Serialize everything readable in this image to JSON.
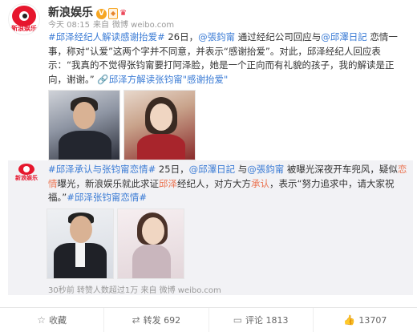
{
  "post": {
    "author": "新浪娱乐",
    "avatar_text": "新浪娱乐",
    "time": "今天 08:15",
    "source_prefix": "来自",
    "source": "微博 weibo.com",
    "tag1": "#邱泽经纪人解读感谢抬爱#",
    "text1": " 26日，",
    "mention1": "@張鈞甯",
    "text2": " 通过经纪公司回应与",
    "mention2": "@邱澤日記",
    "text3": " 恋情一事，称对“认爱”这两个字并不同意，并表示“感谢抬爱”。对此，邱泽经纪人回应表示：“我真的不觉得张钧甯要打阿泽脸，她是一个正向而有礼貌的孩子，我的解读是正向，谢谢。”",
    "link_text": "邱泽方解读张钧甯\"感谢抬爱\""
  },
  "repost": {
    "avatar_text": "新浪娱乐",
    "tag1": "#邱泽承认与张钧甯恋情#",
    "text1": " 25日，",
    "mention1": "@邱澤日記",
    "text2": " 与",
    "mention2": "@張鈞甯",
    "text3": " 被曝光深夜开车兜风，疑似",
    "kw1": "恋情",
    "text4": "曝光，新浪娱乐就此求证",
    "kw2": "邱泽",
    "text5": "经纪人，对方大方",
    "kw3": "承认",
    "text6": "，表示“努力追求中，请大家祝福。”",
    "tag2": "#邱泽张钧甯恋情#",
    "meta": "30秒前 转赞人数超过1万 来自 微博 weibo.com"
  },
  "actions": [
    {
      "label": "收藏",
      "icon": "star-icon"
    },
    {
      "label": "转发 692",
      "icon": "repost-icon"
    },
    {
      "label": "评论 1813",
      "icon": "comment-icon"
    },
    {
      "label": "13707",
      "icon": "like-icon"
    }
  ],
  "colors": {
    "accent": "#eb7350",
    "link": "#3a7bd5",
    "brand": "#e6162d"
  }
}
